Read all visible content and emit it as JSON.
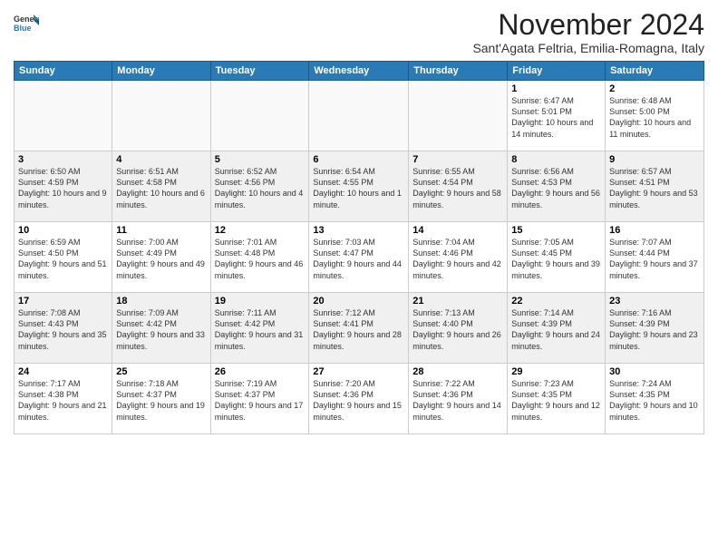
{
  "logo": {
    "line1": "General",
    "line2": "Blue"
  },
  "title": "November 2024",
  "location": "Sant'Agata Feltria, Emilia-Romagna, Italy",
  "headers": [
    "Sunday",
    "Monday",
    "Tuesday",
    "Wednesday",
    "Thursday",
    "Friday",
    "Saturday"
  ],
  "weeks": [
    [
      {
        "day": "",
        "info": ""
      },
      {
        "day": "",
        "info": ""
      },
      {
        "day": "",
        "info": ""
      },
      {
        "day": "",
        "info": ""
      },
      {
        "day": "",
        "info": ""
      },
      {
        "day": "1",
        "info": "Sunrise: 6:47 AM\nSunset: 5:01 PM\nDaylight: 10 hours and 14 minutes."
      },
      {
        "day": "2",
        "info": "Sunrise: 6:48 AM\nSunset: 5:00 PM\nDaylight: 10 hours and 11 minutes."
      }
    ],
    [
      {
        "day": "3",
        "info": "Sunrise: 6:50 AM\nSunset: 4:59 PM\nDaylight: 10 hours and 9 minutes."
      },
      {
        "day": "4",
        "info": "Sunrise: 6:51 AM\nSunset: 4:58 PM\nDaylight: 10 hours and 6 minutes."
      },
      {
        "day": "5",
        "info": "Sunrise: 6:52 AM\nSunset: 4:56 PM\nDaylight: 10 hours and 4 minutes."
      },
      {
        "day": "6",
        "info": "Sunrise: 6:54 AM\nSunset: 4:55 PM\nDaylight: 10 hours and 1 minute."
      },
      {
        "day": "7",
        "info": "Sunrise: 6:55 AM\nSunset: 4:54 PM\nDaylight: 9 hours and 58 minutes."
      },
      {
        "day": "8",
        "info": "Sunrise: 6:56 AM\nSunset: 4:53 PM\nDaylight: 9 hours and 56 minutes."
      },
      {
        "day": "9",
        "info": "Sunrise: 6:57 AM\nSunset: 4:51 PM\nDaylight: 9 hours and 53 minutes."
      }
    ],
    [
      {
        "day": "10",
        "info": "Sunrise: 6:59 AM\nSunset: 4:50 PM\nDaylight: 9 hours and 51 minutes."
      },
      {
        "day": "11",
        "info": "Sunrise: 7:00 AM\nSunset: 4:49 PM\nDaylight: 9 hours and 49 minutes."
      },
      {
        "day": "12",
        "info": "Sunrise: 7:01 AM\nSunset: 4:48 PM\nDaylight: 9 hours and 46 minutes."
      },
      {
        "day": "13",
        "info": "Sunrise: 7:03 AM\nSunset: 4:47 PM\nDaylight: 9 hours and 44 minutes."
      },
      {
        "day": "14",
        "info": "Sunrise: 7:04 AM\nSunset: 4:46 PM\nDaylight: 9 hours and 42 minutes."
      },
      {
        "day": "15",
        "info": "Sunrise: 7:05 AM\nSunset: 4:45 PM\nDaylight: 9 hours and 39 minutes."
      },
      {
        "day": "16",
        "info": "Sunrise: 7:07 AM\nSunset: 4:44 PM\nDaylight: 9 hours and 37 minutes."
      }
    ],
    [
      {
        "day": "17",
        "info": "Sunrise: 7:08 AM\nSunset: 4:43 PM\nDaylight: 9 hours and 35 minutes."
      },
      {
        "day": "18",
        "info": "Sunrise: 7:09 AM\nSunset: 4:42 PM\nDaylight: 9 hours and 33 minutes."
      },
      {
        "day": "19",
        "info": "Sunrise: 7:11 AM\nSunset: 4:42 PM\nDaylight: 9 hours and 31 minutes."
      },
      {
        "day": "20",
        "info": "Sunrise: 7:12 AM\nSunset: 4:41 PM\nDaylight: 9 hours and 28 minutes."
      },
      {
        "day": "21",
        "info": "Sunrise: 7:13 AM\nSunset: 4:40 PM\nDaylight: 9 hours and 26 minutes."
      },
      {
        "day": "22",
        "info": "Sunrise: 7:14 AM\nSunset: 4:39 PM\nDaylight: 9 hours and 24 minutes."
      },
      {
        "day": "23",
        "info": "Sunrise: 7:16 AM\nSunset: 4:39 PM\nDaylight: 9 hours and 23 minutes."
      }
    ],
    [
      {
        "day": "24",
        "info": "Sunrise: 7:17 AM\nSunset: 4:38 PM\nDaylight: 9 hours and 21 minutes."
      },
      {
        "day": "25",
        "info": "Sunrise: 7:18 AM\nSunset: 4:37 PM\nDaylight: 9 hours and 19 minutes."
      },
      {
        "day": "26",
        "info": "Sunrise: 7:19 AM\nSunset: 4:37 PM\nDaylight: 9 hours and 17 minutes."
      },
      {
        "day": "27",
        "info": "Sunrise: 7:20 AM\nSunset: 4:36 PM\nDaylight: 9 hours and 15 minutes."
      },
      {
        "day": "28",
        "info": "Sunrise: 7:22 AM\nSunset: 4:36 PM\nDaylight: 9 hours and 14 minutes."
      },
      {
        "day": "29",
        "info": "Sunrise: 7:23 AM\nSunset: 4:35 PM\nDaylight: 9 hours and 12 minutes."
      },
      {
        "day": "30",
        "info": "Sunrise: 7:24 AM\nSunset: 4:35 PM\nDaylight: 9 hours and 10 minutes."
      }
    ]
  ]
}
